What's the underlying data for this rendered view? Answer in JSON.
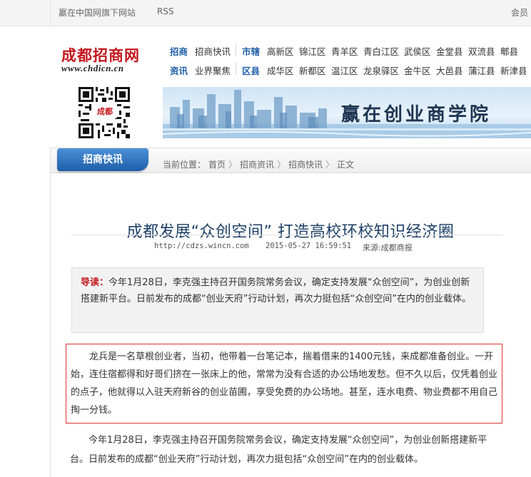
{
  "topbar": {
    "slogan_link": "赢在中国网旗下网站",
    "rss": "RSS",
    "member": "会员"
  },
  "logo": {
    "name": "成都招商网",
    "url_text": "www.chdicn.cn"
  },
  "nav": {
    "row1": {
      "group1": {
        "head": "招商",
        "items": [
          "招商快讯"
        ]
      },
      "group2": {
        "head": "市辖",
        "items": [
          "高新区",
          "锦江区",
          "青羊区",
          "青白江区",
          "武侯区",
          "金堂县",
          "双流县",
          "郫县"
        ]
      }
    },
    "row2": {
      "group1": {
        "head": "资讯",
        "items": [
          "业界聚焦"
        ]
      },
      "group2": {
        "head": "区县",
        "items": [
          "成华区",
          "新都区",
          "温江区",
          "龙泉驿区",
          "金牛区",
          "大邑县",
          "蒲江县",
          "新津县"
        ]
      }
    }
  },
  "qr": {
    "label": "成都"
  },
  "banner": {
    "slogan": "赢在创业商学院"
  },
  "section": {
    "tab": "招商快讯",
    "breadcrumb": {
      "prefix": "当前位置：",
      "items": [
        "首页",
        "招商资讯",
        "招商快讯",
        "正文"
      ]
    }
  },
  "article": {
    "title": "成都发展“众创空间” 打造高校环校知识经济圈",
    "source_url": "http://cdzs.wincn.com",
    "datetime": "2015-05-27 16:59:51",
    "source": "来源:成都商报",
    "lead_label": "导读：",
    "lead_text": "今年1月28日，李克强主持召开国务院常务会议，确定支持发展“众创空间”，为创业创新搭建新平台。日前发布的成都“创业天府”行动计划，再次力挺包括“众创空间”在内的创业载体。",
    "highlight_text": "龙兵是一名草根创业者，当初，他带着一台笔记本，揣着借来的1400元钱，来成都准备创业。一开始，连住宿都得和好哥们挤在一张床上的他，常常为没有合适的办公场地发愁。但不久以后，仅凭着创业的点子，他就得以入驻天府新谷的创业苗圃，享受免费的办公场地。甚至，连水电费、物业费都不用自己掏一分钱。",
    "para1": "今年1月28日，李克强主持召开国务院常务会议，确定支持发展“众创空间”，为创业创新搭建新平台。日前发布的成都“创业天府”行动计划，再次力挺包括“众创空间”在内的创业载体。"
  },
  "colors": {
    "brand_red": "#c4161c",
    "nav_blue": "#1f5fa8",
    "title_blue": "#1c3f66",
    "tab_blue": "#1e5ea9",
    "highlight_border": "#d9372f"
  }
}
